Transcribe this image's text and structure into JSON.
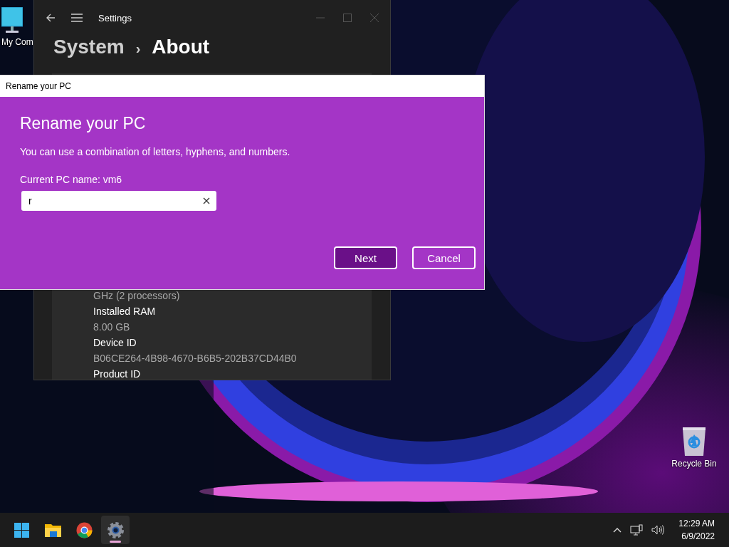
{
  "desktop_icons": [
    {
      "kind": "computer",
      "label": "My Com"
    },
    {
      "kind": "recycle",
      "label": "Recycle Bin"
    }
  ],
  "settings_window": {
    "title": "Settings",
    "breadcrumb": [
      "System",
      "›",
      "About"
    ],
    "details": [
      {
        "kind": "value",
        "text": "GHz  (2 processors)"
      },
      {
        "kind": "label",
        "text": "Installed RAM"
      },
      {
        "kind": "value",
        "text": "8.00 GB"
      },
      {
        "kind": "label",
        "text": "Device ID"
      },
      {
        "kind": "value",
        "text": "B06CE264-4B98-4670-B6B5-202B37CD44B0"
      },
      {
        "kind": "label",
        "text": "Product ID"
      }
    ]
  },
  "dialog": {
    "title": "Rename your PC",
    "heading": "Rename your PC",
    "description": "You can use a combination of letters, hyphens, and numbers.",
    "current_name": "Current PC name: vm6",
    "input": {
      "value": "r"
    },
    "buttons": [
      {
        "label": "Next",
        "primary": true
      },
      {
        "label": "Cancel",
        "primary": false
      }
    ]
  },
  "taskbar": {
    "apps": [
      {
        "kind": "start",
        "active": false
      },
      {
        "kind": "explorer",
        "active": false
      },
      {
        "kind": "browser",
        "active": false
      },
      {
        "kind": "settings",
        "active": true
      }
    ],
    "clock": {
      "time": "12:29 AM",
      "date": "6/9/2022"
    }
  }
}
